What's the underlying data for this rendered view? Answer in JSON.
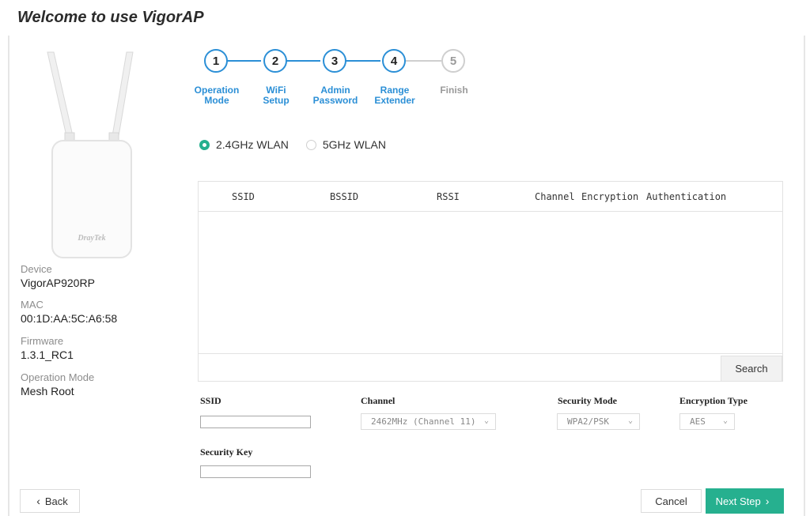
{
  "page": {
    "title": "Welcome to use VigorAP"
  },
  "device_info": {
    "brand_logo": "DrayTek",
    "device_label": "Device",
    "device_value": "VigorAP920RP",
    "mac_label": "MAC",
    "mac_value": "00:1D:AA:5C:A6:58",
    "firmware_label": "Firmware",
    "firmware_value": "1.3.1_RC1",
    "opmode_label": "Operation Mode",
    "opmode_value": "Mesh Root"
  },
  "stepper": {
    "steps": [
      {
        "num": "1",
        "line1": "Operation",
        "line2": "Mode",
        "active": true
      },
      {
        "num": "2",
        "line1": "WiFi",
        "line2": "Setup",
        "active": true
      },
      {
        "num": "3",
        "line1": "Admin",
        "line2": "Password",
        "active": true
      },
      {
        "num": "4",
        "line1": "Range",
        "line2": "Extender",
        "active": true
      },
      {
        "num": "5",
        "line1": "Finish",
        "line2": "",
        "active": false
      }
    ],
    "active_color": "#2b8fd6",
    "inactive_color": "#cfcfcf"
  },
  "band": {
    "options": [
      {
        "label": "2.4GHz WLAN",
        "selected": true
      },
      {
        "label": "5GHz WLAN",
        "selected": false
      }
    ]
  },
  "scan_table": {
    "columns": [
      "SSID",
      "BSSID",
      "RSSI",
      "Channel",
      "Encryption",
      "Authentication"
    ],
    "rows": [],
    "search_label": "Search"
  },
  "form": {
    "ssid_label": "SSID",
    "ssid_value": "",
    "channel_label": "Channel",
    "channel_value": "2462MHz (Channel 11)",
    "security_mode_label": "Security Mode",
    "security_mode_value": "WPA2/PSK",
    "encryption_label": "Encryption Type",
    "encryption_value": "AES",
    "security_key_label": "Security Key",
    "security_key_value": ""
  },
  "footer": {
    "back_label": "Back",
    "cancel_label": "Cancel",
    "next_label": "Next Step"
  },
  "colors": {
    "accent": "#26b08f",
    "step_blue": "#2b8fd6"
  }
}
